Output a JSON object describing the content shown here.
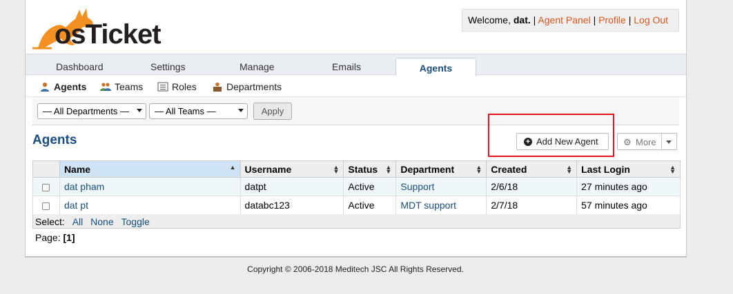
{
  "header": {
    "logo_text": "osTicket",
    "welcome_prefix": "Welcome,",
    "username": "dat.",
    "links": [
      "Agent Panel",
      "Profile",
      "Log Out"
    ],
    "separator": "|"
  },
  "nav": {
    "tabs": [
      "Dashboard",
      "Settings",
      "Manage",
      "Emails"
    ],
    "active_tab": "Agents"
  },
  "subnav": {
    "items": [
      "Agents",
      "Teams",
      "Roles",
      "Departments"
    ],
    "active": "Agents"
  },
  "filters": {
    "department": "— All Departments —",
    "team": "— All Teams —",
    "apply": "Apply"
  },
  "page": {
    "title": "Agents",
    "add_button": "Add New Agent",
    "more_button": "More"
  },
  "table": {
    "columns": [
      "Name",
      "Username",
      "Status",
      "Department",
      "Created",
      "Last Login"
    ],
    "sorted_column": "Name",
    "rows": [
      {
        "name": "dat pham",
        "username": "datpt",
        "status": "Active",
        "department": "Support",
        "created": "2/6/18",
        "last_login": "27 minutes ago"
      },
      {
        "name": "dat pt",
        "username": "databc123",
        "status": "Active",
        "department": "MDT support",
        "created": "2/7/18",
        "last_login": "57 minutes ago"
      }
    ],
    "select_label": "Select:",
    "select_options": [
      "All",
      "None",
      "Toggle"
    ]
  },
  "pager": {
    "label": "Page:",
    "current": "[1]"
  },
  "footer": {
    "copyright": "Copyright © 2006-2018 Meditech JSC All Rights Reserved."
  },
  "colors": {
    "link_orange": "#e0531a",
    "link_blue": "#184e81",
    "highlight_red": "#e8101a",
    "logo_orange": "#f39021"
  }
}
